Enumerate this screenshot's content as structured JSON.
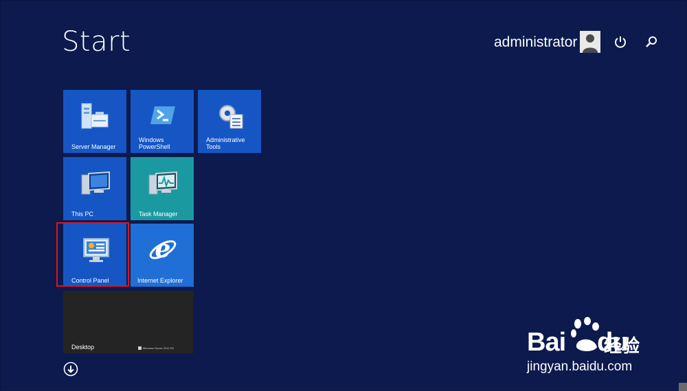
{
  "header": {
    "title": "Start",
    "user_name": "administrator"
  },
  "tiles": [
    {
      "label": "Server Manager",
      "icon": "server-manager-icon"
    },
    {
      "label": "Windows PowerShell",
      "icon": "powershell-icon"
    },
    {
      "label": "Administrative Tools",
      "icon": "administrative-tools-icon"
    },
    {
      "label": "This PC",
      "icon": "this-pc-icon"
    },
    {
      "label": "Task Manager",
      "icon": "task-manager-icon"
    },
    {
      "label": "Control Panel",
      "icon": "control-panel-icon"
    },
    {
      "label": "Internet Explorer",
      "icon": "internet-explorer-icon"
    },
    {
      "label": "Desktop",
      "icon": "desktop-icon"
    }
  ],
  "desktop_brand": "Windows Server 2012 R2",
  "watermark": {
    "brand": "Bai",
    "brand_suffix": "du",
    "cn": "经验",
    "url": "jingyan.baidu.com"
  },
  "colors": {
    "background": "#0c1a4e",
    "tile_blue": "#1656c4",
    "tile_teal": "#1a9aa0",
    "highlight": "#e0141e"
  }
}
